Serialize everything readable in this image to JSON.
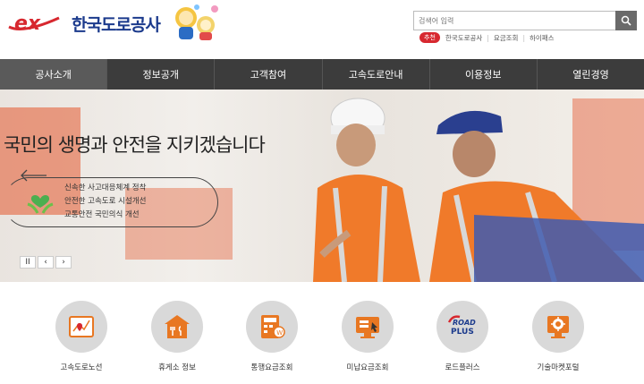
{
  "header": {
    "logo_mark": "ex",
    "logo_text": "한국도로공사",
    "search_placeholder": "검색어 입력",
    "recommend_badge": "추천",
    "quick_links": [
      "한국도로공사",
      "요금조회",
      "하이패스"
    ]
  },
  "nav": {
    "items": [
      "공사소개",
      "정보공개",
      "고객참여",
      "고속도로안내",
      "이용정보",
      "열린경영"
    ],
    "active_index": 0
  },
  "banner": {
    "title": "국민의 생명과 안전을 지키겠습니다",
    "lines": [
      "신속한 사고대응체계 정착",
      "안전한 고속도로 시설개선",
      "교통안전 국민의식 개선"
    ],
    "controls": {
      "pause": "II",
      "prev": "‹",
      "next": "›"
    }
  },
  "quick_menu": [
    {
      "label": "고속도로노선",
      "icon": "map-pin-icon"
    },
    {
      "label": "휴게소 정보",
      "icon": "rest-area-icon"
    },
    {
      "label": "통행요금조회",
      "icon": "toll-calculator-icon"
    },
    {
      "label": "미납요금조회",
      "icon": "unpaid-fee-icon"
    },
    {
      "label": "로드플러스",
      "icon": "road-plus-icon"
    },
    {
      "label": "기술마켓포털",
      "icon": "tech-market-icon"
    }
  ],
  "road_plus_text": {
    "top": "ROAD",
    "bottom": "PLUS"
  },
  "colors": {
    "brand_red": "#d7282f",
    "brand_blue": "#1b3a8c",
    "nav_bg": "#3c3c3c",
    "icon_orange": "#e87722"
  }
}
